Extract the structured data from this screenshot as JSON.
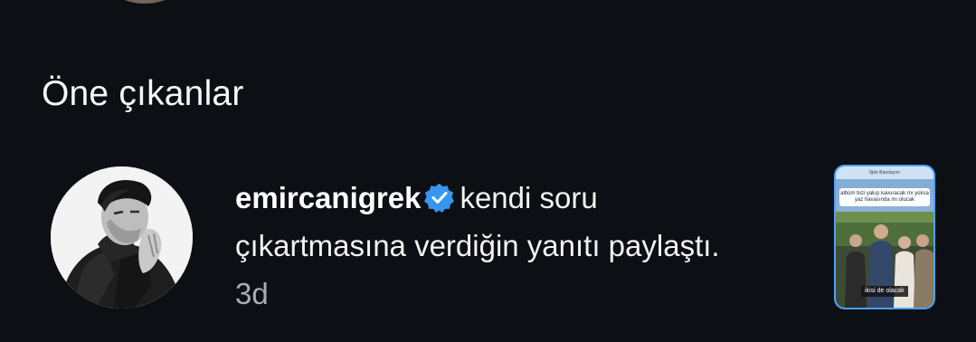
{
  "section": {
    "title": "Öne çıkanlar"
  },
  "notification": {
    "username": "emircanigrek",
    "verified": true,
    "action_text": "kendi soru çıkartmasına verdiğin yanıtı paylaştı.",
    "time": "3d",
    "avatar_icon": "user-avatar",
    "story_thumbnail": {
      "header": "İğde Bandayım",
      "question": "albüm bizi yakıp kavuracak mı yoksa yaz havasında mı olucak",
      "caption": "ikisi de olacak"
    }
  },
  "colors": {
    "background": "#0c0f14",
    "text": "#f2f2f2",
    "muted": "#a8adb5",
    "verified_badge": "#3797f0",
    "story_border": "#4aa3ff"
  }
}
